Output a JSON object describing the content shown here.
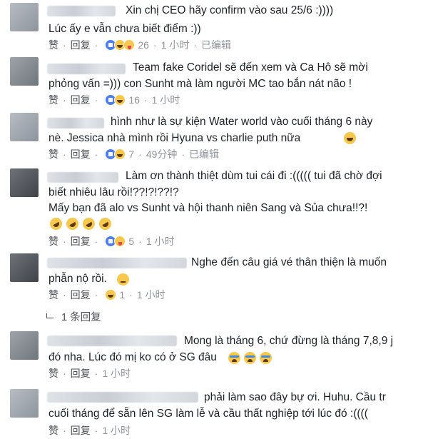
{
  "comments": [
    {
      "lines": [
        "Xin chị CEO hãy confirm vào sau 25/6 :))))",
        "Lúc ấy e vẫn chưa biết điểm :))"
      ],
      "like": "赞",
      "reply": "回复",
      "reaction_count": "26",
      "time": "1 小时",
      "edited": "已编辑"
    },
    {
      "lines": [
        "Team fake Coridel sẽ đến xem và Ca Hô sẽ mời",
        "phỏng vấn =))) con Sunht mà làm người MC tao bắn nát não !"
      ],
      "like": "赞",
      "reply": "回复",
      "reaction_count": "16",
      "time": "1 小时",
      "edited": ""
    },
    {
      "lines": [
        "hình như là sự kiện Water world vào cuối tháng 6 này",
        "nè. Jessica nhà mình rồi Hyuna vs charlie puth nữa"
      ],
      "like": "赞",
      "reply": "回复",
      "reaction_count": "7",
      "time": "49分钟",
      "edited": "已编辑"
    },
    {
      "lines": [
        "Làm ơn thành thiệt dùm tui cái đi :((((( tui đã chờ đợi",
        "biết nhiêu lâu rồi!??!?!??!?",
        "Mấy bạn đã alo vs Sunht và hội thanh niên Sang và Sủa chưa!!?!"
      ],
      "like": "赞",
      "reply": "回复",
      "reaction_count": "5",
      "time": "1 小时",
      "edited": ""
    },
    {
      "lines": [
        "Nghe đến câu giá vé thân thiện là muốn",
        "phẫn nộ rồi."
      ],
      "like": "赞",
      "reply": "回复",
      "reaction_count": "1",
      "time": "1 小时",
      "edited": ""
    },
    {
      "lines": [
        "Mong là tháng 6, chứ đừng là tháng 7,8,9 j",
        "đó nha. Lúc đó mị ko có ở SG đâu"
      ],
      "like": "赞",
      "reply": "回复",
      "reaction_count": "",
      "time": "1 小时",
      "edited": ""
    },
    {
      "lines": [
        "phải làm sao đây bự ơi. Huhu. Cầu tr",
        "cuối tháng để sẵn lên SG làm lễ và cầu thất nghiệp tới lúc đó :(((("
      ],
      "like": "赞",
      "reply": "回复",
      "reaction_count": "",
      "time": "1 小时",
      "edited": ""
    }
  ],
  "replies_link": "1 条回复",
  "colors": {
    "text": "#1d2129",
    "meta": "#4b4f56",
    "muted": "#90949c",
    "like_blue": "#4c7ef3",
    "reaction_yellow": "#f7c84b"
  }
}
